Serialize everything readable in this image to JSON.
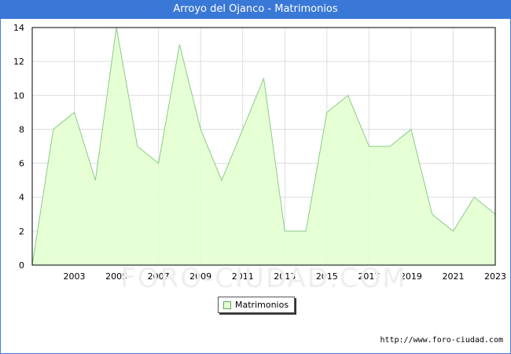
{
  "header": {
    "title": "Arroyo del Ojanco - Matrimonios"
  },
  "chart_data": {
    "type": "area",
    "title": "Arroyo del Ojanco - Matrimonios",
    "x": [
      2001,
      2002,
      2003,
      2004,
      2005,
      2006,
      2007,
      2008,
      2009,
      2010,
      2011,
      2012,
      2013,
      2014,
      2015,
      2016,
      2017,
      2018,
      2019,
      2020,
      2021,
      2022,
      2023
    ],
    "series": [
      {
        "name": "Matrimonios",
        "values": [
          0,
          8,
          9,
          5,
          14,
          7,
          6,
          13,
          8,
          5,
          8,
          11,
          2,
          2,
          9,
          10,
          7,
          7,
          8,
          3,
          2,
          4,
          3
        ]
      }
    ],
    "x_tick_labels": [
      "2003",
      "2005",
      "2007",
      "2009",
      "2011",
      "2013",
      "2015",
      "2017",
      "2019",
      "2021",
      "2023"
    ],
    "y_tick_labels": [
      "0",
      "2",
      "4",
      "6",
      "8",
      "10",
      "12",
      "14"
    ],
    "xlim": [
      2001,
      2023
    ],
    "ylim": [
      0,
      14
    ],
    "grid": true,
    "legend": "bottom-center",
    "colors": {
      "fill": "#e3ffd0",
      "line": "#88cc88",
      "grid": "#dddddd",
      "title_bar": "#3a78d8"
    }
  },
  "watermark": "FORO-CIUDAD.COM",
  "footer": {
    "url": "http://www.foro-ciudad.com"
  }
}
